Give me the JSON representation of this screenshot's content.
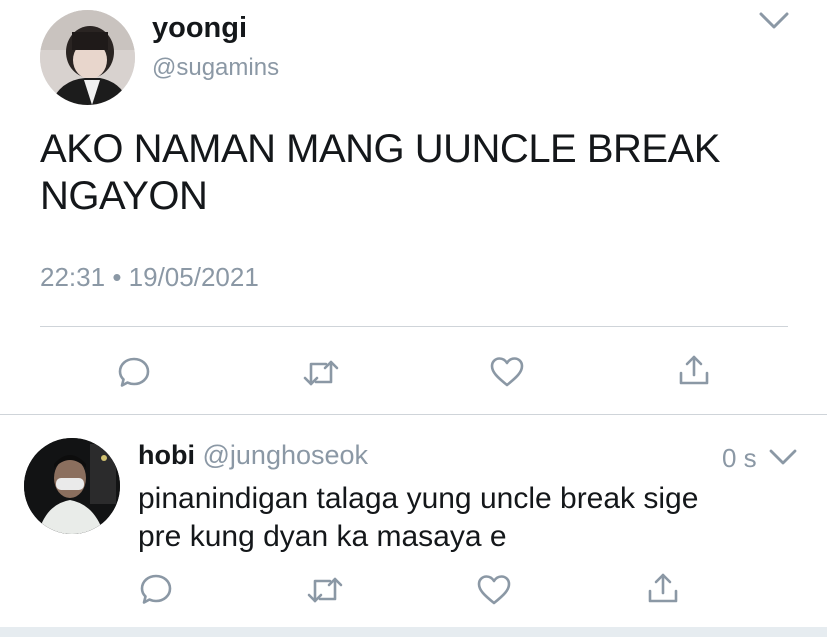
{
  "main_tweet": {
    "name": "yoongi",
    "handle": "@sugamins",
    "text": "AKO NAMAN MANG UUNCLE BREAK NGAYON",
    "time": "22:31",
    "separator": "•",
    "date": "19/05/2021",
    "avatar_icon": "avatar-photo",
    "menu_icon": "chevron-down-icon"
  },
  "reply": {
    "name": "hobi",
    "handle": "@junghoseok",
    "age": "0 s",
    "text_line1": "pinanindigan talaga yung uncle break sige",
    "text_line2": "pre kung dyan ka masaya e",
    "avatar_icon": "avatar-photo",
    "menu_icon": "chevron-down-icon"
  },
  "actions": [
    "reply-icon",
    "retweet-icon",
    "like-icon",
    "share-icon"
  ],
  "colors": {
    "icon": "#8b98a5",
    "text": "#14171a",
    "divider": "#cfd4d9"
  }
}
